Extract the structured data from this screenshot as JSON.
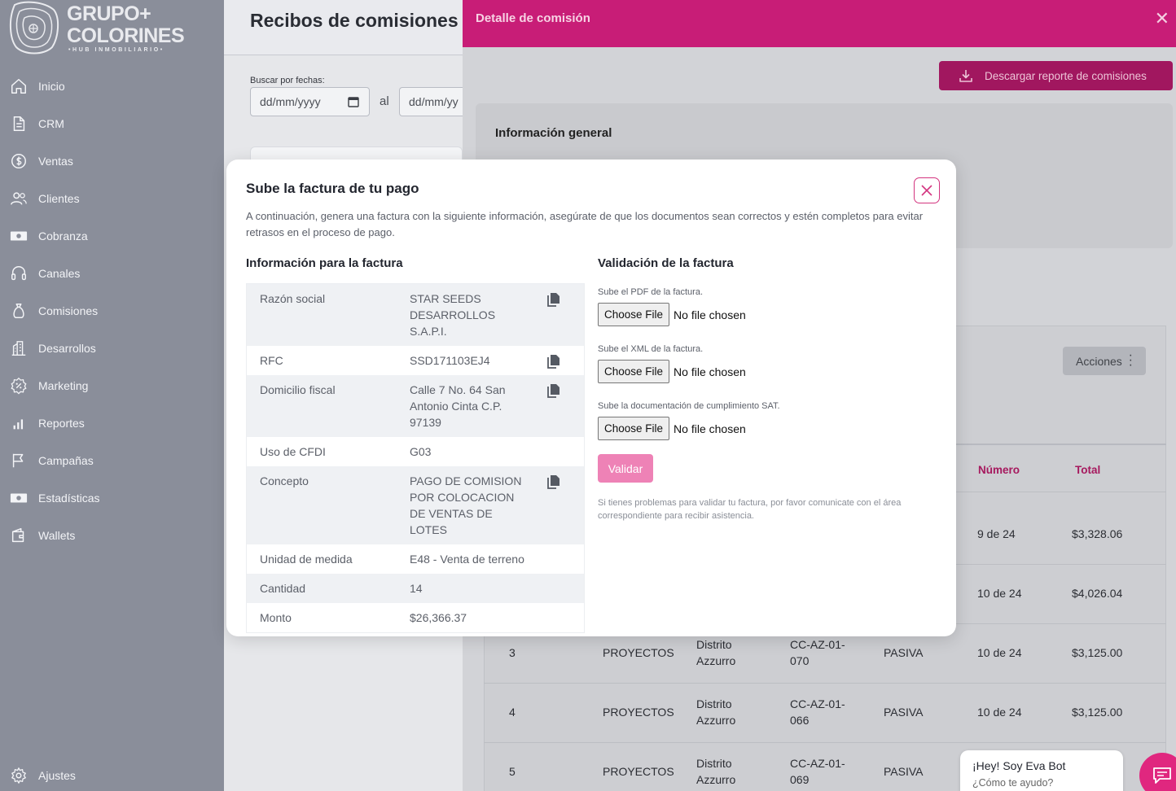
{
  "brand": {
    "name_line1": "GRUPO+",
    "name_line2": "COLORINES",
    "tagline": "•HUB INMOBILIARIO•"
  },
  "sidebar": {
    "items": [
      {
        "label": "Inicio",
        "icon": "home-icon"
      },
      {
        "label": "CRM",
        "icon": "document-icon"
      },
      {
        "label": "Ventas",
        "icon": "dollar-icon"
      },
      {
        "label": "Clientes",
        "icon": "users-icon"
      },
      {
        "label": "Cobranza",
        "icon": "cash-icon"
      },
      {
        "label": "Canales",
        "icon": "headset-icon"
      },
      {
        "label": "Comisiones",
        "icon": "money-bag-icon"
      },
      {
        "label": "Desarrollos",
        "icon": "building-icon"
      },
      {
        "label": "Marketing",
        "icon": "percent-icon"
      },
      {
        "label": "Reportes",
        "icon": "bar-chart-icon"
      },
      {
        "label": "Campañas",
        "icon": "flag-icon"
      },
      {
        "label": "Estadísticas",
        "icon": "cash-icon"
      },
      {
        "label": "Wallets",
        "icon": "wallet-icon"
      }
    ],
    "settings_label": "Ajustes"
  },
  "page": {
    "title": "Recibos de comisiones",
    "search_label": "Buscar por fechas:",
    "date_placeholder": "dd/mm/yyyy",
    "date_placeholder_2": "dd/mm/yy",
    "date_separator": "al"
  },
  "drawer": {
    "title": "Detalle de comisión",
    "download_label": "Descargar reporte de comisiones",
    "info_title": "Información general",
    "actions_label": "Acciones",
    "columns": {
      "numero": "Número",
      "total": "Total"
    },
    "rows": [
      {
        "numero": "9 de 24",
        "total": "$3,328.06"
      },
      {
        "numero": "10 de 24",
        "total": "$4,026.04"
      },
      {
        "idx": "3",
        "tipo": "PROYECTOS",
        "desarrollo": "Distrito Azzurro",
        "lote": "CC-AZ-01-070",
        "estado": "PASIVA",
        "numero": "10 de 24",
        "total": "$3,125.00"
      },
      {
        "idx": "4",
        "tipo": "PROYECTOS",
        "desarrollo": "Distrito Azzurro",
        "lote": "CC-AZ-01-066",
        "estado": "PASIVA",
        "numero": "10 de 24",
        "total": "$3,125.00"
      },
      {
        "idx": "5",
        "tipo": "PROYECTOS",
        "desarrollo": "Distrito Azzurro",
        "lote": "CC-AZ-01-069",
        "estado": "PASIVA"
      }
    ]
  },
  "modal": {
    "title": "Sube la factura de tu pago",
    "description": "A continuación, genera una factura con la siguiente información, asegúrate de que los documentos sean correctos y estén completos para evitar retrasos en el proceso de pago.",
    "left_title": "Información para la factura",
    "right_title": "Validación de la factura",
    "invoice": [
      {
        "key": "Razón social",
        "value": "STAR SEEDS DESARROLLOS S.A.P.I.",
        "copy": true
      },
      {
        "key": "RFC",
        "value": "SSD171103EJ4",
        "copy": true
      },
      {
        "key": "Domicilio fiscal",
        "value": "Calle 7 No. 64 San Antonio Cinta C.P. 97139",
        "copy": true
      },
      {
        "key": "Uso de CFDI",
        "value": "G03",
        "copy": false
      },
      {
        "key": "Concepto",
        "value": "PAGO DE COMISION POR COLOCACION DE VENTAS DE LOTES",
        "copy": true
      },
      {
        "key": "Unidad de medida",
        "value": "E48 - Venta de terreno",
        "copy": false
      },
      {
        "key": "Cantidad",
        "value": "14",
        "copy": false
      },
      {
        "key": "Monto",
        "value": "$26,366.37",
        "copy": false
      }
    ],
    "uploads": [
      {
        "label": "Sube el PDF de la factura."
      },
      {
        "label": "Sube el XML de la factura."
      },
      {
        "label": "Sube la documentación de cumplimiento SAT."
      }
    ],
    "choose_file_label": "Choose File",
    "no_file_label": "No file chosen",
    "validate_label": "Validar",
    "help_text": "Si tienes problemas para validar tu factura, por favor comunicate con el área correspondiente para recibir asistencia."
  },
  "bot": {
    "greeting": "¡Hey! Soy Eva Bot",
    "prompt": "¿Cómo te ayudo?"
  },
  "colors": {
    "accent": "#c81d77",
    "accent_light": "#ee82b6",
    "sidebar": "#8a8e9a"
  }
}
